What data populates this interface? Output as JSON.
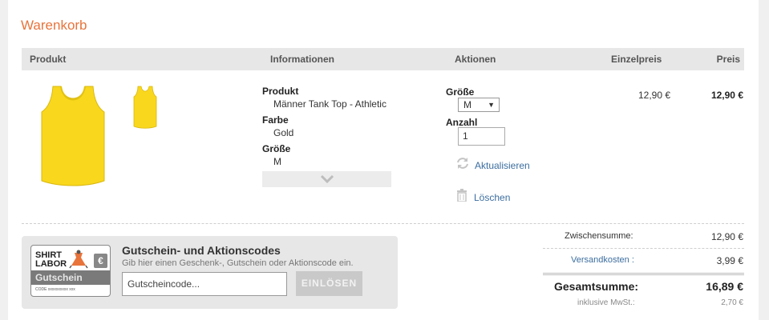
{
  "cart": {
    "title": "Warenkorb",
    "columns": {
      "product": "Produkt",
      "information": "Informationen",
      "actions": "Aktionen",
      "unit_price": "Einzelpreis",
      "price": "Preis"
    },
    "item": {
      "info": [
        {
          "label": "Produkt",
          "value": "Männer Tank Top - Athletic"
        },
        {
          "label": "Farbe",
          "value": "Gold"
        },
        {
          "label": "Größe",
          "value": "M"
        }
      ],
      "size_label": "Größe",
      "size_value": "M",
      "qty_label": "Anzahl",
      "qty_value": "1",
      "update_label": "Aktualisieren",
      "delete_label": "Löschen",
      "unit_price": "12,90 €",
      "price": "12,90 €",
      "color": "#f9d71c"
    },
    "voucher": {
      "title": "Gutschein- und Aktionscodes",
      "description": "Gib hier einen Geschenk-, Gutschein oder Aktionscode ein.",
      "placeholder": "Gutscheincode...",
      "button": "EINLÖSEN",
      "logo": {
        "line1": "SHIRT",
        "line2": "LABOR",
        "line3": "Gutschein",
        "code": "CODE xxxxxxxxxx xxx",
        "currency": "€"
      }
    },
    "summary": {
      "subtotal_label": "Zwischensumme:",
      "subtotal_value": "12,90 €",
      "shipping_label": "Versandkosten :",
      "shipping_value": "3,99 €",
      "total_label": "Gesamtsumme:",
      "total_value": "16,89 €",
      "vat_label": "inklusive MwSt.:",
      "vat_value": "2,70 €"
    },
    "colors": {
      "accent": "#e8743b",
      "link": "#3c6e9f",
      "header_bg": "#e7e7e7"
    }
  }
}
